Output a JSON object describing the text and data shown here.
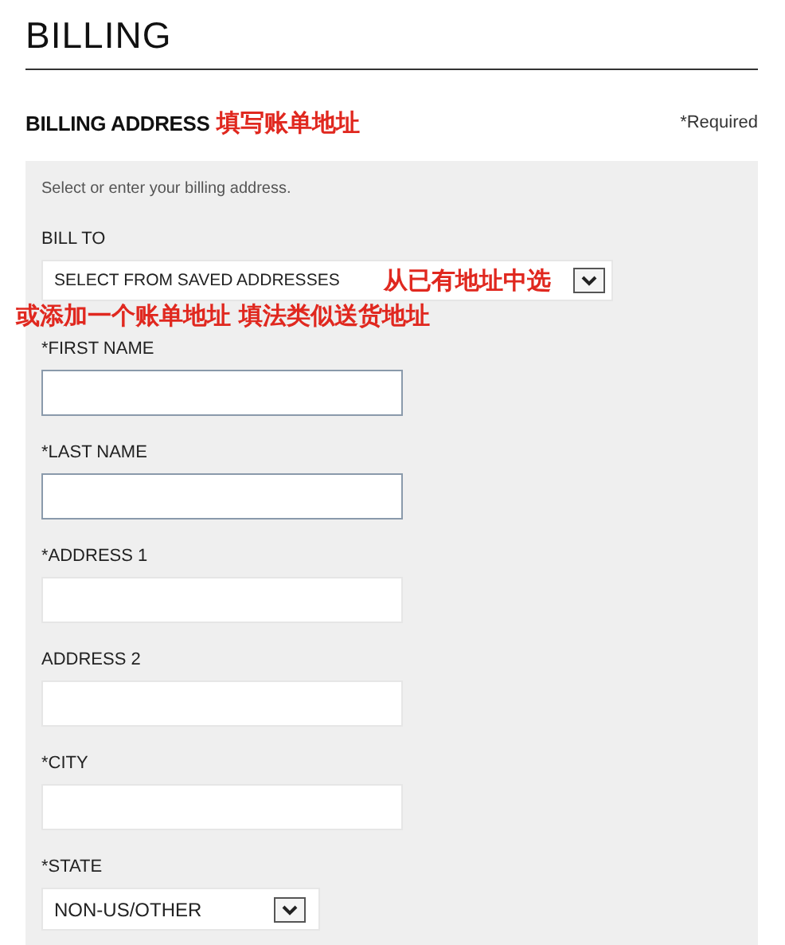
{
  "page": {
    "title": "BILLING"
  },
  "section": {
    "title": "BILLING ADDRESS",
    "annotation": "填写账单地址",
    "required_note": "*Required"
  },
  "panel": {
    "intro": "Select or enter your billing address.",
    "bill_to": {
      "label": "BILL TO",
      "value": "SELECT FROM SAVED ADDRESSES",
      "annotation": "从已有地址中选"
    },
    "annotation": "或添加一个账单地址 填法类似送货地址",
    "fields": [
      {
        "kind": "text",
        "label": "*FIRST NAME",
        "outlined": true
      },
      {
        "kind": "text",
        "label": "*LAST NAME",
        "outlined": true
      },
      {
        "kind": "text",
        "label": "*ADDRESS 1",
        "outlined": false
      },
      {
        "kind": "text",
        "label": "ADDRESS 2",
        "outlined": false
      },
      {
        "kind": "text",
        "label": "*CITY",
        "outlined": false
      },
      {
        "kind": "select",
        "label": "*STATE",
        "value": "NON-US/OTHER"
      }
    ]
  }
}
